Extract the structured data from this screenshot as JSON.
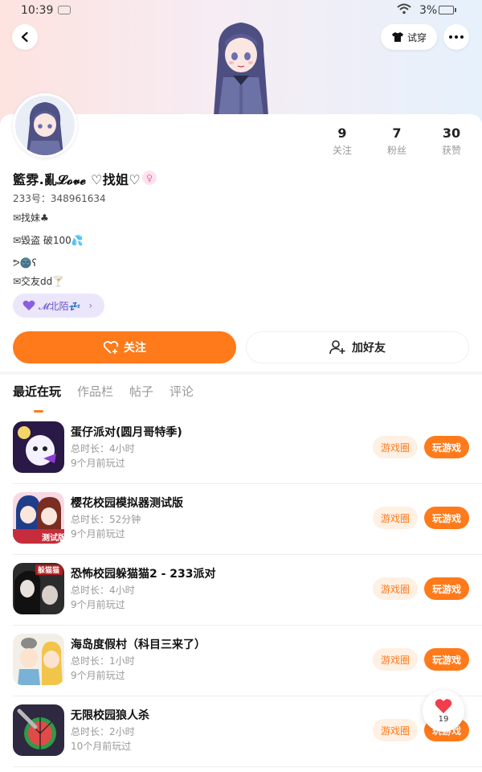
{
  "status_bar": {
    "time": "10:39",
    "battery": "3%"
  },
  "header": {
    "try_on_label": "试穿"
  },
  "profile": {
    "nickname": "籃雰.亂𝓛𝓸𝓿𝓮 ♡找姐♡",
    "uid": "233号：348961634",
    "bio": [
      "✉找妹♣",
      "✉毀盗 破100💦",
      "ᕗ🌚ʕ",
      "✉交友dd🍸"
    ],
    "stats": [
      {
        "value": "9",
        "label": "关注"
      },
      {
        "value": "7",
        "label": "粉丝"
      },
      {
        "value": "30",
        "label": "获赞"
      }
    ],
    "friend_chip": "𝓜北陌💤"
  },
  "actions": {
    "follow": "关注",
    "add_friend": "加好友"
  },
  "tabs": [
    {
      "label": "最近在玩",
      "active": true
    },
    {
      "label": "作品栏",
      "active": false
    },
    {
      "label": "帖子",
      "active": false
    },
    {
      "label": "评论",
      "active": false
    }
  ],
  "games": [
    {
      "name": "蛋仔派对(圆月哥特季)",
      "total": "总时长：4小时",
      "last": "9个月前玩过",
      "circle": "游戏圈",
      "play": "玩游戏",
      "icon": "eggy-party-icon"
    },
    {
      "name": "樱花校园模拟器测试版",
      "total": "总时长：52分钟",
      "last": "9个月前玩过",
      "circle": "游戏圈",
      "play": "玩游戏",
      "icon": "sakura-school-icon",
      "badge": "测试版"
    },
    {
      "name": "恐怖校园躲猫猫2 - 233派对",
      "total": "总时长：4小时",
      "last": "9个月前玩过",
      "circle": "游戏圈",
      "play": "玩游戏",
      "icon": "horror-school-icon",
      "badge": "躲猫猫"
    },
    {
      "name": "海岛度假村（科目三来了）",
      "total": "总时长：1小时",
      "last": "9个月前玩过",
      "circle": "游戏圈",
      "play": "玩游戏",
      "icon": "island-resort-icon"
    },
    {
      "name": "无限校园狼人杀",
      "total": "总时长：2小时",
      "last": "10个月前玩过",
      "circle": "游戏圈",
      "play": "玩游戏",
      "icon": "werewolf-icon"
    }
  ],
  "like_float": {
    "count": "19"
  },
  "colors": {
    "accent": "#ff7a1a",
    "accent_light": "#fff0e4",
    "chip_bg": "#ece6fb"
  }
}
